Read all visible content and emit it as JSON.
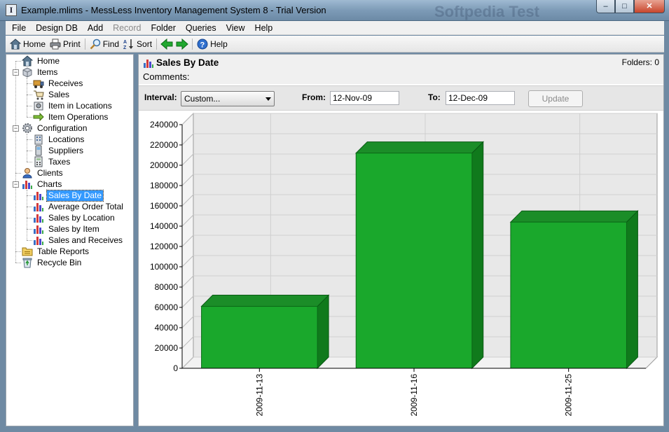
{
  "window": {
    "app_letter": "I",
    "title": "Example.mlims - MessLess Inventory Management System 8 - Trial Version",
    "watermark": "Softpedia Test",
    "min": "–",
    "max": "□",
    "close": "✕"
  },
  "menu": [
    {
      "label": "File",
      "enabled": true
    },
    {
      "label": "Design DB",
      "enabled": true
    },
    {
      "label": "Add",
      "enabled": true
    },
    {
      "label": "Record",
      "enabled": false
    },
    {
      "label": "Folder",
      "enabled": true
    },
    {
      "label": "Queries",
      "enabled": true
    },
    {
      "label": "View",
      "enabled": true
    },
    {
      "label": "Help",
      "enabled": true
    }
  ],
  "toolbar": {
    "home": "Home",
    "print": "Print",
    "find": "Find",
    "sort": "Sort",
    "help": "Help"
  },
  "tree": [
    {
      "label": "Home",
      "icon": "home-icon"
    },
    {
      "label": "Items",
      "icon": "box-icon"
    },
    {
      "label": "Receives",
      "icon": "truck-icon"
    },
    {
      "label": "Sales",
      "icon": "cart-icon"
    },
    {
      "label": "Item in Locations",
      "icon": "item-location-icon"
    },
    {
      "label": "Item Operations",
      "icon": "arrow-icon"
    },
    {
      "label": "Configuration",
      "icon": "gear-icon"
    },
    {
      "label": "Locations",
      "icon": "building-icon"
    },
    {
      "label": "Suppliers",
      "icon": "phone-icon"
    },
    {
      "label": "Taxes",
      "icon": "calculator-icon"
    },
    {
      "label": "Clients",
      "icon": "user-icon"
    },
    {
      "label": "Charts",
      "icon": "chart-icon"
    },
    {
      "label": "Sales By Date",
      "icon": "chart-icon"
    },
    {
      "label": "Average Order Total",
      "icon": "chart-icon"
    },
    {
      "label": "Sales by Location",
      "icon": "chart-icon"
    },
    {
      "label": "Sales by Item",
      "icon": "chart-icon"
    },
    {
      "label": "Sales and Receives",
      "icon": "chart-icon"
    },
    {
      "label": "Table Reports",
      "icon": "report-icon"
    },
    {
      "label": "Recycle Bin",
      "icon": "recycle-icon"
    }
  ],
  "header": {
    "title": "Sales By Date",
    "folders": "Folders: 0",
    "comments": "Comments:"
  },
  "filter": {
    "interval_label": "Interval:",
    "interval_value": "Custom...",
    "from_label": "From:",
    "from_value": "12-Nov-09",
    "to_label": "To:",
    "to_value": "12-Dec-09",
    "update_label": "Update"
  },
  "chart_data": {
    "type": "bar",
    "categories": [
      "2009-11-13",
      "2009-11-16",
      "2009-11-25"
    ],
    "values": [
      61000,
      212000,
      144000
    ],
    "ylim": [
      0,
      240000
    ],
    "yticks": [
      0,
      20000,
      40000,
      60000,
      80000,
      100000,
      120000,
      140000,
      160000,
      180000,
      200000,
      220000,
      240000
    ],
    "bar_color": "#1aa82c",
    "grid": true,
    "style": "3d"
  }
}
